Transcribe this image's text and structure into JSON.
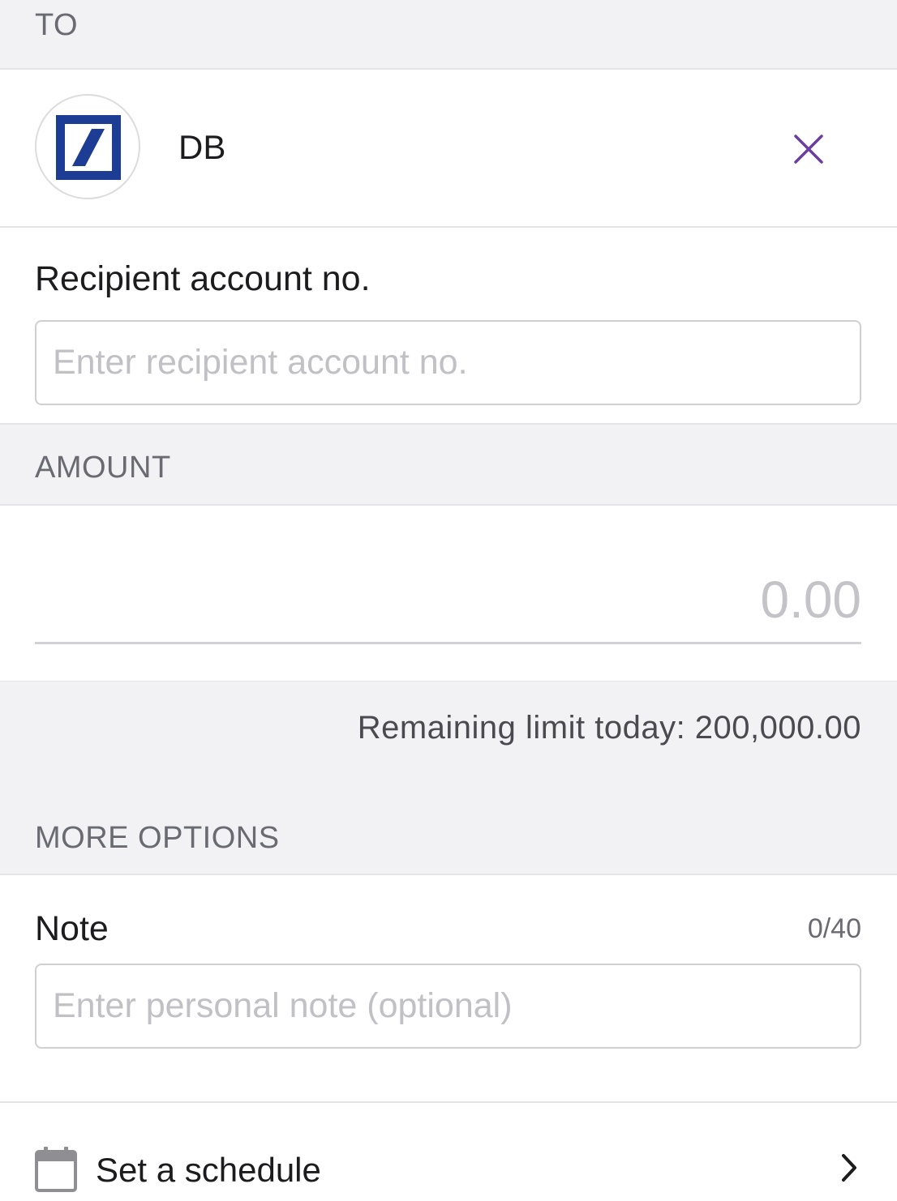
{
  "to_section": {
    "header": "TO",
    "recipient_bank": {
      "name": "DB",
      "logo": "deutsche-bank-logo",
      "brand_color": "#1d3c94"
    },
    "clear_icon": "close-icon",
    "accent_color": "#6b3fa0"
  },
  "account": {
    "label": "Recipient account no.",
    "value": "",
    "placeholder": "Enter recipient account no."
  },
  "amount_section": {
    "header": "AMOUNT",
    "value": "",
    "placeholder": "0.00",
    "remaining_limit": "Remaining limit today: 200,000.00"
  },
  "more_options": {
    "header": "MORE OPTIONS",
    "note": {
      "label": "Note",
      "counter": "0/40",
      "value": "",
      "placeholder": "Enter personal note (optional)"
    },
    "schedule": {
      "label": "Set a schedule",
      "icon": "calendar-icon",
      "chevron": "chevron-right-icon"
    }
  }
}
